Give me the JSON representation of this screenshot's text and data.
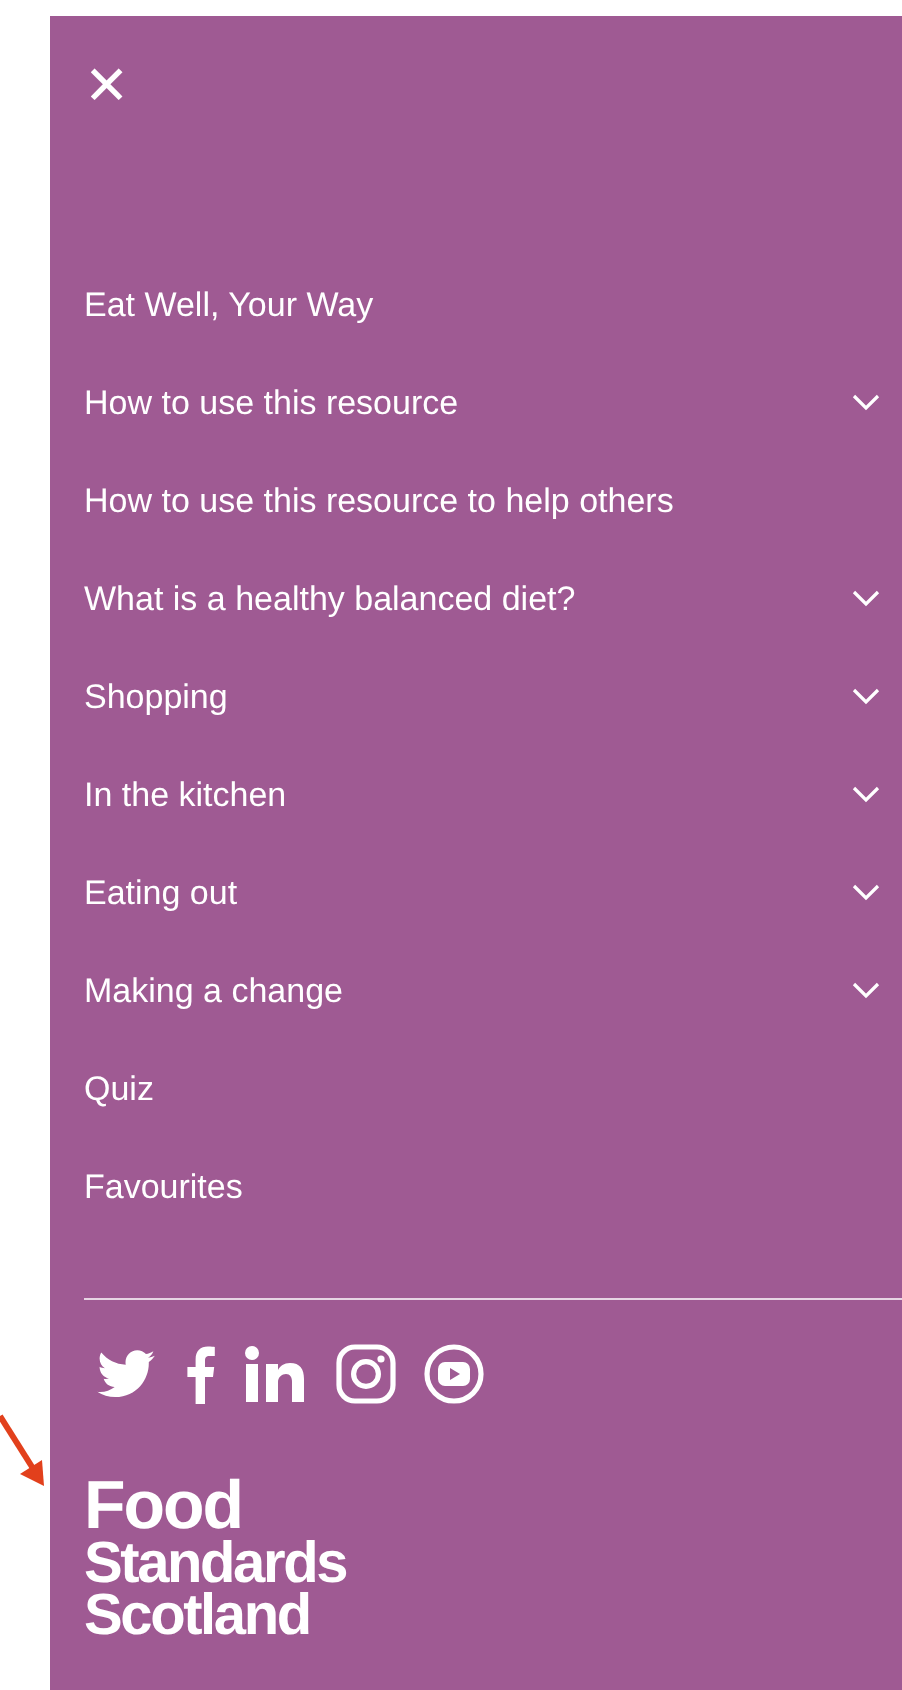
{
  "menu": {
    "close_label": "✕",
    "items": [
      {
        "label": "Eat Well, Your Way",
        "expandable": false
      },
      {
        "label": "How to use this resource",
        "expandable": true
      },
      {
        "label": "How to use this resource to help others",
        "expandable": false
      },
      {
        "label": "What is a healthy balanced diet?",
        "expandable": true
      },
      {
        "label": "Shopping",
        "expandable": true
      },
      {
        "label": "In the kitchen",
        "expandable": true
      },
      {
        "label": "Eating out",
        "expandable": true
      },
      {
        "label": "Making a change",
        "expandable": true
      },
      {
        "label": "Quiz",
        "expandable": false
      },
      {
        "label": "Favourites",
        "expandable": false
      }
    ]
  },
  "social": [
    {
      "kind": "twitter"
    },
    {
      "kind": "facebook"
    },
    {
      "kind": "linkedin"
    },
    {
      "kind": "instagram"
    },
    {
      "kind": "youtube"
    }
  ],
  "logo": {
    "lines": [
      "Food",
      "Standards",
      "Scotland"
    ]
  }
}
